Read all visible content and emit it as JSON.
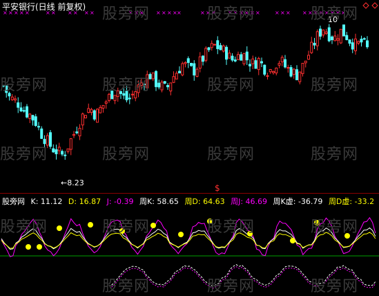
{
  "header": {
    "title": "平安银行(日线 前复权)"
  },
  "watermark": "股旁网",
  "price_panel": {
    "high_label": "10",
    "low_label": "←8.23",
    "event_marker": "$"
  },
  "indicator_bar": {
    "name": "股旁网",
    "items": [
      {
        "label": "K: 11.12",
        "color": "#ffffff"
      },
      {
        "label": "D: 16.87",
        "color": "#ffff00"
      },
      {
        "label": "J: -0.39",
        "color": "#ff00ff"
      },
      {
        "label": "周K: 58.65",
        "color": "#ffffff"
      },
      {
        "label": "周D: 64.63",
        "color": "#ffff00"
      },
      {
        "label": "周J: 46.69",
        "color": "#ff00ff"
      },
      {
        "label": "周K虚: -36.79",
        "color": "#ffffff"
      },
      {
        "label": "周D虚: -33.2",
        "color": "#ffff00"
      }
    ]
  },
  "colors": {
    "up": "#ff3030",
    "down": "#54ffff",
    "k_line": "#ffffff",
    "d_line": "#ffff00",
    "j_line": "#ff00ff",
    "signal_dot": "#ffff00",
    "zero_line": "#00a000",
    "cross_marker": "#ff00ff",
    "diamond": "#ff3030"
  },
  "chart_data": [
    {
      "type": "candlestick",
      "title": "平安银行(日线 前复权)",
      "annotations": [
        "10",
        "8.23"
      ],
      "close_path": [
        9.2,
        9.05,
        9.0,
        8.95,
        8.85,
        8.8,
        8.7,
        8.55,
        8.45,
        8.35,
        8.3,
        8.25,
        8.4,
        8.55,
        8.7,
        8.85,
        8.9,
        8.8,
        8.9,
        9.0,
        9.1,
        9.15,
        9.05,
        9.0,
        9.1,
        9.2,
        9.3,
        9.35,
        9.25,
        9.2,
        9.15,
        9.3,
        9.4,
        9.5,
        9.45,
        9.4,
        9.5,
        9.6,
        9.7,
        9.75,
        9.7,
        9.65,
        9.55,
        9.6,
        9.65,
        9.55,
        9.5,
        9.55,
        9.45,
        9.4,
        9.5,
        9.55,
        9.45,
        9.4,
        9.35,
        9.45,
        9.6,
        9.75,
        9.9,
        10.0,
        9.9,
        9.85,
        9.95,
        9.9,
        9.8,
        9.75,
        9.8,
        9.7
      ]
    },
    {
      "type": "line",
      "series": [
        {
          "name": "K"
        },
        {
          "name": "D"
        },
        {
          "name": "J"
        },
        {
          "name": "周K"
        },
        {
          "name": "周D"
        },
        {
          "name": "周J"
        },
        {
          "name": "周K虚"
        },
        {
          "name": "周D虚"
        }
      ],
      "last_values": {
        "K": 11.12,
        "D": 16.87,
        "J": -0.39,
        "周K": 58.65,
        "周D": 64.63,
        "周J": 46.69,
        "周K虚": -36.79,
        "周D虚": -33.2
      }
    }
  ]
}
